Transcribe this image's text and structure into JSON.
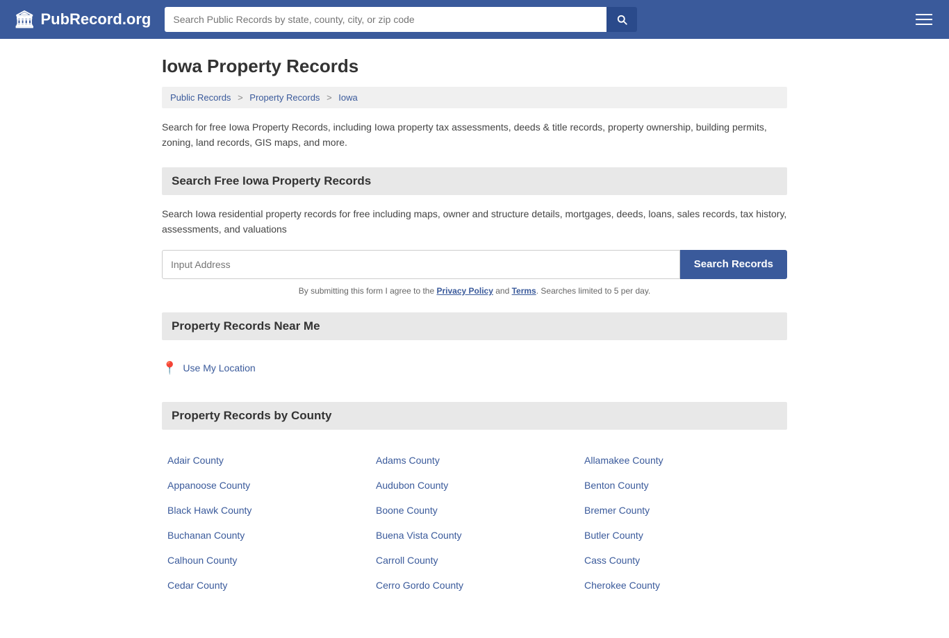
{
  "header": {
    "logo_icon": "🏛",
    "logo_text": "PubRecord.org",
    "search_placeholder": "Search Public Records by state, county, city, or zip code",
    "search_value": ""
  },
  "page": {
    "title": "Iowa Property Records",
    "breadcrumb": [
      {
        "label": "Public Records",
        "href": "#"
      },
      {
        "label": "Property Records",
        "href": "#"
      },
      {
        "label": "Iowa",
        "href": "#"
      }
    ],
    "description": "Search for free Iowa Property Records, including Iowa property tax assessments, deeds & title records, property ownership, building permits, zoning, land records, GIS maps, and more.",
    "search_section": {
      "heading": "Search Free Iowa Property Records",
      "desc": "Search Iowa residential property records for free including maps, owner and structure details, mortgages, deeds, loans, sales records, tax history, assessments, and valuations",
      "input_placeholder": "Input Address",
      "button_label": "Search Records",
      "disclaimer_pre": "By submitting this form I agree to the ",
      "disclaimer_privacy": "Privacy Policy",
      "disclaimer_mid": " and ",
      "disclaimer_terms": "Terms",
      "disclaimer_post": ". Searches limited to 5 per day."
    },
    "near_me": {
      "heading": "Property Records Near Me",
      "link_label": "Use My Location"
    },
    "by_county": {
      "heading": "Property Records by County",
      "counties": [
        "Adair County",
        "Adams County",
        "Allamakee County",
        "Appanoose County",
        "Audubon County",
        "Benton County",
        "Black Hawk County",
        "Boone County",
        "Bremer County",
        "Buchanan County",
        "Buena Vista County",
        "Butler County",
        "Calhoun County",
        "Carroll County",
        "Cass County",
        "Cedar County",
        "Cerro Gordo County",
        "Cherokee County"
      ]
    }
  }
}
